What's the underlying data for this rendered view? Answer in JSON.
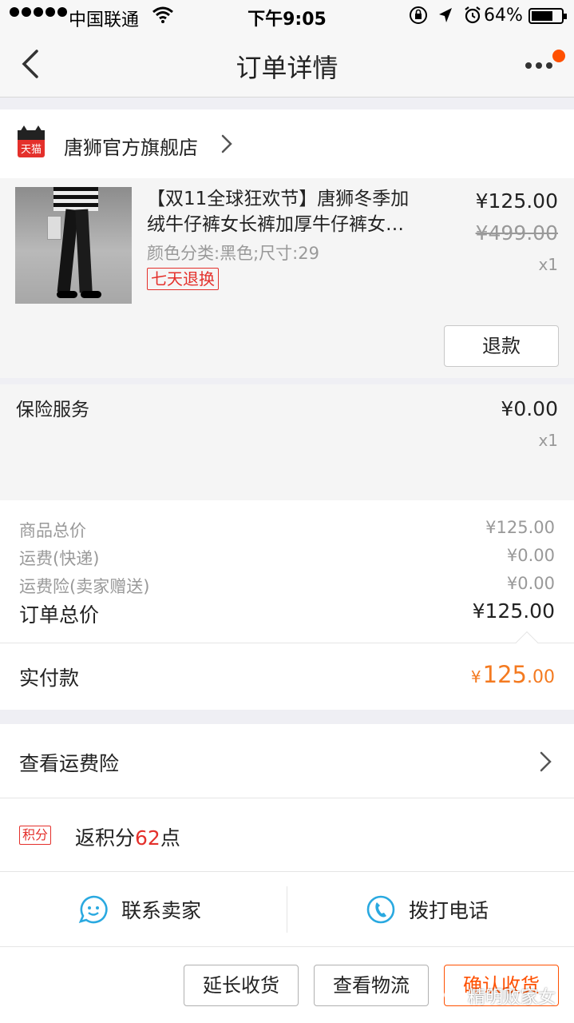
{
  "status_bar": {
    "carrier": "中国联通",
    "time": "下午9:05",
    "battery_percent": "64%",
    "battery_level": 0.64,
    "icons": [
      "signal-dots-icon",
      "wifi-icon",
      "rotation-lock-icon",
      "location-icon",
      "alarm-icon",
      "battery-icon"
    ]
  },
  "nav": {
    "title": "订单详情",
    "icons": [
      "back-chevron-icon",
      "more-dots-icon"
    ],
    "badge_color": "#ff5000"
  },
  "shop": {
    "logo_text": "天猫",
    "name": "唐狮官方旗舰店",
    "icon": "chevron-right-icon"
  },
  "item": {
    "title_line1": "【双11全球狂欢节】唐狮冬季加",
    "title_line2": "绒牛仔裤女长裤加厚牛仔裤女…",
    "spec": "颜色分类:黑色;尺寸:29",
    "tag": "七天退换",
    "price": "¥125.00",
    "original_price": "¥499.00",
    "quantity": "x1",
    "refund_button": "退款"
  },
  "insurance": {
    "label": "保险服务",
    "price": "¥0.00",
    "quantity": "x1"
  },
  "summary": {
    "rows": [
      {
        "label": "商品总价",
        "value": "¥125.00"
      },
      {
        "label": "运费(快递)",
        "value": "¥0.00"
      },
      {
        "label": "运费险(卖家赠送)",
        "value": "¥0.00"
      }
    ],
    "total_label": "订单总价",
    "total_value": "¥125.00"
  },
  "paid": {
    "label": "实付款",
    "currency": "¥",
    "amount_int": "125",
    "amount_dec": ".00",
    "color": "#f47a20"
  },
  "freight_insurance": {
    "label": "查看运费险"
  },
  "points": {
    "badge": "积分",
    "text_prefix": "返积分",
    "value": "62",
    "text_suffix": "点"
  },
  "contact": {
    "seller": "联系卖家",
    "phone": "拨打电话",
    "icon_color": "#2aa9e0"
  },
  "footer": {
    "extend": "延长收货",
    "logistics": "查看物流",
    "confirm": "确认收货",
    "accent": "#ff5000"
  },
  "watermark": {
    "text": "精明败家女"
  }
}
